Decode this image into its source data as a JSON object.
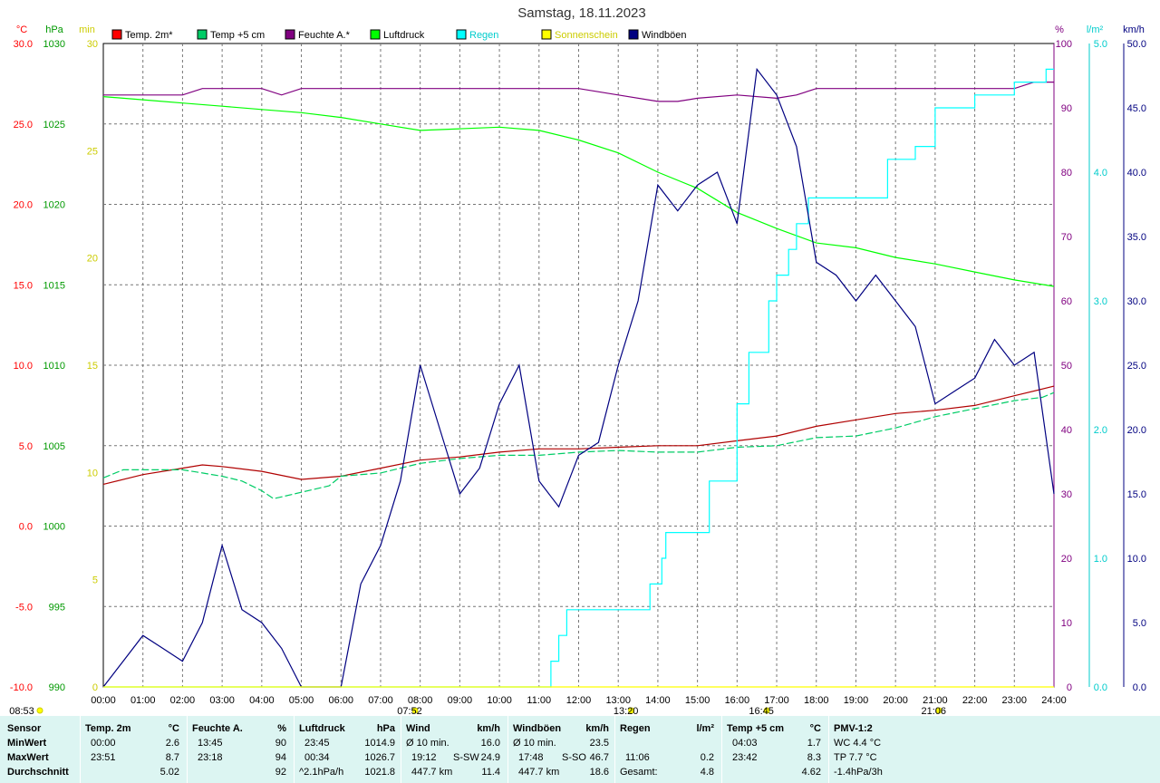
{
  "chart_data": {
    "type": "line",
    "title": "Samstag, 18.11.2023",
    "axes_left": [
      {
        "unit": "°C",
        "color": "#ff0000",
        "ticks": [
          "30.0",
          "25.0",
          "20.0",
          "15.0",
          "10.0",
          "5.0",
          "0.0",
          "-5.0",
          "-10.0"
        ],
        "ylim": [
          -10,
          30
        ]
      },
      {
        "unit": "hPa",
        "color": "#009900",
        "ticks": [
          "1030",
          "1025",
          "1020",
          "1015",
          "1010",
          "1005",
          "1000",
          "995",
          "990"
        ],
        "ylim": [
          990,
          1030
        ]
      },
      {
        "unit": "min",
        "color": "#cccc00",
        "ticks": [
          "30",
          "25",
          "20",
          "15",
          "10",
          "5",
          "0"
        ],
        "ylim": [
          0,
          30
        ]
      }
    ],
    "axes_right": [
      {
        "unit": "%",
        "color": "#800080",
        "ticks": [
          "100",
          "90",
          "80",
          "70",
          "60",
          "50",
          "40",
          "30",
          "20",
          "10",
          "0"
        ],
        "ylim": [
          0,
          100
        ]
      },
      {
        "unit": "l/m²",
        "color": "#00cccc",
        "ticks": [
          "5.0",
          "4.0",
          "3.0",
          "2.0",
          "1.0",
          "0.0"
        ],
        "ylim": [
          0,
          5
        ]
      },
      {
        "unit": "km/h",
        "color": "#000080",
        "ticks": [
          "50.0",
          "45.0",
          "40.0",
          "35.0",
          "30.0",
          "25.0",
          "20.0",
          "15.0",
          "10.0",
          "5.0",
          "0.0"
        ],
        "ylim": [
          0,
          50
        ]
      }
    ],
    "x_ticks": [
      "00:00",
      "01:00",
      "02:00",
      "03:00",
      "04:00",
      "05:00",
      "06:00",
      "07:00",
      "08:00",
      "09:00",
      "10:00",
      "11:00",
      "12:00",
      "13:00",
      "14:00",
      "15:00",
      "16:00",
      "17:00",
      "18:00",
      "19:00",
      "20:00",
      "21:00",
      "22:00",
      "23:00",
      "24:00"
    ],
    "markers": [
      {
        "label": "08:53",
        "x": 0.25
      },
      {
        "label": "07:52",
        "x": 7.87
      },
      {
        "label": "13:20",
        "x": 13.33
      },
      {
        "label": "16:45",
        "x": 16.75
      },
      {
        "label": "21:06",
        "x": 21.1
      }
    ],
    "legend": [
      {
        "name": "Temp. 2m*",
        "color": "#ff0000"
      },
      {
        "name": "Temp +5 cm",
        "color": "#00cc66"
      },
      {
        "name": "Feuchte A.*",
        "color": "#800080"
      },
      {
        "name": "Luftdruck",
        "color": "#00ff00"
      },
      {
        "name": "Regen",
        "color": "#00ffff"
      },
      {
        "name": "Sonnenschein",
        "color": "#ffff00"
      },
      {
        "name": "Windböen",
        "color": "#000080"
      }
    ],
    "series": [
      {
        "name": "Temp. 2m*",
        "axis": "°C",
        "color": "#b00000",
        "x": [
          0,
          1,
          2,
          2.5,
          3,
          4,
          5,
          6,
          7,
          8,
          9,
          10,
          11,
          12,
          13,
          14,
          15,
          16,
          17,
          18,
          19,
          20,
          21,
          22,
          23,
          24
        ],
        "y": [
          2.6,
          3.2,
          3.6,
          3.8,
          3.7,
          3.4,
          2.9,
          3.1,
          3.6,
          4.1,
          4.3,
          4.6,
          4.8,
          4.8,
          4.9,
          5.0,
          5.0,
          5.3,
          5.6,
          6.2,
          6.6,
          7.0,
          7.2,
          7.5,
          8.1,
          8.7
        ]
      },
      {
        "name": "Temp +5 cm",
        "axis": "°C",
        "color": "#00cc66",
        "x": [
          0,
          0.5,
          1,
          2,
          2.5,
          3,
          3.5,
          4,
          4.3,
          5,
          5.7,
          6,
          7,
          8,
          9,
          10,
          11,
          12,
          13,
          14,
          15,
          16,
          17,
          18,
          19,
          20,
          21,
          22,
          23,
          23.7,
          24
        ],
        "y": [
          3.0,
          3.5,
          3.5,
          3.5,
          3.3,
          3.1,
          2.8,
          2.2,
          1.7,
          2.1,
          2.5,
          3.1,
          3.3,
          3.9,
          4.2,
          4.4,
          4.4,
          4.6,
          4.7,
          4.6,
          4.6,
          4.9,
          5.0,
          5.5,
          5.6,
          6.1,
          6.8,
          7.3,
          7.8,
          8.0,
          8.3
        ]
      },
      {
        "name": "Feuchte A.*",
        "axis": "%",
        "color": "#800080",
        "x": [
          0,
          1,
          2,
          2.5,
          3,
          4,
          4.5,
          5,
          5.5,
          6,
          7,
          8,
          9,
          10,
          11,
          12,
          13,
          14,
          14.5,
          15,
          16,
          17,
          17.5,
          18,
          19,
          20,
          21,
          22,
          23,
          23.5,
          24
        ],
        "y": [
          92,
          92,
          92,
          93,
          93,
          93,
          92,
          93,
          93,
          93,
          93,
          93,
          93,
          93,
          93,
          93,
          92,
          91,
          91,
          91.5,
          92,
          91.5,
          92,
          93,
          93,
          93,
          93,
          93,
          93,
          94,
          94
        ]
      },
      {
        "name": "Luftdruck",
        "axis": "hPa",
        "color": "#00ff00",
        "x": [
          0,
          1,
          2,
          3,
          4,
          5,
          6,
          7,
          8,
          9,
          10,
          11,
          12,
          13,
          14,
          15,
          16,
          17,
          18,
          19,
          20,
          21,
          22,
          23,
          24
        ],
        "y": [
          1026.7,
          1026.5,
          1026.3,
          1026.1,
          1025.9,
          1025.7,
          1025.4,
          1025.0,
          1024.6,
          1024.7,
          1024.8,
          1024.6,
          1024.0,
          1023.2,
          1022.0,
          1021.0,
          1019.5,
          1018.5,
          1017.6,
          1017.3,
          1016.7,
          1016.3,
          1015.8,
          1015.3,
          1014.9
        ]
      },
      {
        "name": "Regen",
        "axis": "l/m²",
        "color": "#00ffff",
        "x": [
          0,
          11.0,
          11.3,
          11.5,
          11.7,
          13.0,
          13.8,
          14.1,
          14.2,
          14.8,
          15.3,
          16.0,
          16.3,
          16.8,
          17.0,
          17.3,
          17.5,
          17.8,
          18.2,
          18.5,
          19.0,
          19.8,
          20.5,
          21.0,
          22.0,
          23.0,
          23.8,
          24.0
        ],
        "y": [
          0,
          0,
          0.2,
          0.4,
          0.6,
          0.6,
          0.8,
          1.0,
          1.2,
          1.2,
          1.6,
          2.2,
          2.6,
          3.0,
          3.2,
          3.4,
          3.6,
          3.8,
          3.8,
          3.8,
          3.8,
          4.1,
          4.2,
          4.5,
          4.6,
          4.7,
          4.8,
          4.8
        ]
      },
      {
        "name": "Windböen",
        "axis": "km/h",
        "color": "#000080",
        "x": [
          0,
          0.5,
          1,
          1.5,
          2,
          2.5,
          3,
          3.5,
          4,
          4.5,
          5,
          5.5,
          6,
          6.5,
          7,
          7.5,
          8,
          8.5,
          9,
          9.5,
          10,
          10.5,
          11,
          11.5,
          12,
          12.5,
          13,
          13.5,
          14,
          14.5,
          15,
          15.5,
          16,
          16.5,
          17,
          17.5,
          18,
          18.5,
          19,
          19.5,
          20,
          20.5,
          21,
          21.5,
          22,
          22.5,
          23,
          23.5,
          24
        ],
        "y": [
          0,
          2,
          4,
          3,
          2,
          5,
          11,
          6,
          5,
          3,
          0,
          0,
          0,
          8,
          11,
          16,
          25,
          20,
          15,
          17,
          22,
          25,
          16,
          14,
          18,
          19,
          25,
          30,
          39,
          37,
          39,
          40,
          36,
          48,
          46,
          42,
          33,
          32,
          30,
          32,
          30,
          28,
          22,
          23,
          24,
          27,
          25,
          26,
          15
        ]
      },
      {
        "name": "Sonnenschein",
        "axis": "min",
        "color": "#ffff00",
        "x": [
          0,
          24
        ],
        "y": [
          0,
          0
        ]
      }
    ]
  },
  "stats": {
    "headers": {
      "sensor": "Sensor",
      "temp2m": "Temp. 2m",
      "temp2m_unit": "°C",
      "feuchte": "Feuchte A.",
      "feuchte_unit": "%",
      "luftdruck": "Luftdruck",
      "luftdruck_unit": "hPa",
      "wind": "Wind",
      "wind_unit": "km/h",
      "windboen": "Windböen",
      "windboen_unit": "km/h",
      "regen": "Regen",
      "regen_unit": "l/m²",
      "temp5": "Temp +5 cm",
      "temp5_unit": "°C",
      "pmv": "PMV-1:2"
    },
    "rows": [
      {
        "label": "MinWert",
        "t2_time": "00:00",
        "t2_val": "2.6",
        "hum_time": "13:45",
        "hum_val": "90",
        "press_time": "23:45",
        "press_val": "1014.9",
        "wind_label": "Ø 10 min.",
        "wind_dir": "",
        "wind_val": "16.0",
        "gust_label": "Ø 10 min.",
        "gust_dir": "",
        "gust_val": "23.5",
        "rain_label": "",
        "rain_val": "",
        "t5_time": "04:03",
        "t5_val": "1.7",
        "pmv": "WC 4.4 °C"
      },
      {
        "label": "MaxWert",
        "t2_time": "23:51",
        "t2_val": "8.7",
        "hum_time": "23:18",
        "hum_val": "94",
        "press_time": "00:34",
        "press_val": "1026.7",
        "wind_label": "19:12",
        "wind_dir": "S-SW",
        "wind_val": "24.9",
        "gust_label": "17:48",
        "gust_dir": "S-SO",
        "gust_val": "46.7",
        "rain_label": "11:06",
        "rain_val": "0.2",
        "t5_time": "23:42",
        "t5_val": "8.3",
        "pmv": "TP 7.7 °C"
      },
      {
        "label": "Durchschnitt",
        "t2_time": "",
        "t2_val": "5.02",
        "hum_time": "",
        "hum_val": "92",
        "press_time": "^2.1hPa/h",
        "press_val": "1021.8",
        "wind_label": "447.7 km",
        "wind_dir": "",
        "wind_val": "11.4",
        "gust_label": "447.7 km",
        "gust_dir": "",
        "gust_val": "18.6",
        "rain_label": "Gesamt:",
        "rain_val": "4.8",
        "t5_time": "",
        "t5_val": "4.62",
        "pmv": "-1.4hPa/3h"
      }
    ]
  }
}
